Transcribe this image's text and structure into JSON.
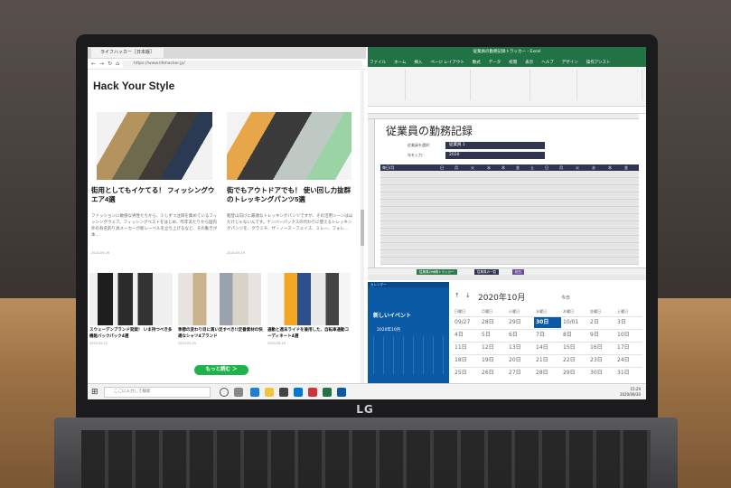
{
  "browser": {
    "tab_label": "ライフハッカー［日本版］",
    "url": "https://www.lifehacker.jp/",
    "site_title": "Hack Your Style",
    "articles": [
      {
        "title": "街用としてもイケてる！ フィッシングウエア4選",
        "desc": "ファッションに敏感な男性たちから、少しずつ注目を集めているフィッシングウェア。フィッシングベストをはじめ、昨年あたりから国内外の有名釣り具メーカーが新レーベルを立ち上げるなど、その動きが本…",
        "date": "2020.09.26"
      },
      {
        "title": "街でもアウトドアでも！ 使い回し力抜群のトレッキングパンツ5選",
        "desc": "軽登山向けに最適なトレッキングパンツですが、その活用シーンは山だけじゃないんです。ナンバーパックスの代わりに使えるトレッキングパンツを、グラミチ、ザ・ノース・フェイス、ミレー、フォレ…",
        "date": "2020.09.19"
      }
    ],
    "small_articles": [
      {
        "title": "スウェーデンブランド発案！ いま持つべき多機能バックパック4選",
        "date": "2020.09.12"
      },
      {
        "title": "季節の変わり目に買い足すべき!!定番素材の快適なシャツ4ブランド",
        "date": "2020.09.05"
      },
      {
        "title": "通勤と週末ライドを兼用した、自転車通勤コーディネート4選",
        "date": "2020.08.29"
      }
    ],
    "more_button": "もっと読む ＞"
  },
  "excel": {
    "window_title": "従業員の勤務記録トラッカー - Excel",
    "menu": [
      "ファイル",
      "ホーム",
      "挿入",
      "ページ レイアウト",
      "数式",
      "データ",
      "校閲",
      "表示",
      "ヘルプ",
      "デザイン",
      "操作アシスト"
    ],
    "heading": "従業員の勤務記録",
    "employee_label": "従業員を選択:",
    "employee_value": "従業員 1",
    "year_label": "年を入力:",
    "year_value": "2020",
    "month_col": "毎日/月",
    "weekdays": [
      "日",
      "月",
      "火",
      "水",
      "木",
      "金",
      "土",
      "日",
      "月",
      "火",
      "水",
      "木",
      "金"
    ],
    "sheets": [
      "従業員の休暇トラッカー",
      "従業員の一覧",
      "祝日"
    ]
  },
  "calendar": {
    "app_title": "カレンダー",
    "new_event": "新しいイベント",
    "mini_month": "2020年10月",
    "month": "2020年10月",
    "today_label": "今日",
    "weekdays": [
      "日曜日",
      "月曜日",
      "火曜日",
      "水曜日",
      "木曜日",
      "金曜日",
      "土曜日"
    ],
    "rows": [
      [
        "09/27",
        "28日",
        "29日",
        "30日",
        "10/01",
        "2日",
        "3日"
      ],
      [
        "4日",
        "5日",
        "6日",
        "7日",
        "8日",
        "9日",
        "10日"
      ],
      [
        "11日",
        "12日",
        "13日",
        "14日",
        "15日",
        "16日",
        "17日"
      ],
      [
        "18日",
        "19日",
        "20日",
        "21日",
        "22日",
        "23日",
        "24日"
      ],
      [
        "25日",
        "26日",
        "27日",
        "28日",
        "29日",
        "30日",
        "31日"
      ]
    ],
    "today_cell": "30日"
  },
  "taskbar": {
    "search_placeholder": "ここに入力して検索",
    "clock_time": "15:29",
    "clock_date": "2020/09/30"
  },
  "brand": {
    "logo": "LG"
  }
}
